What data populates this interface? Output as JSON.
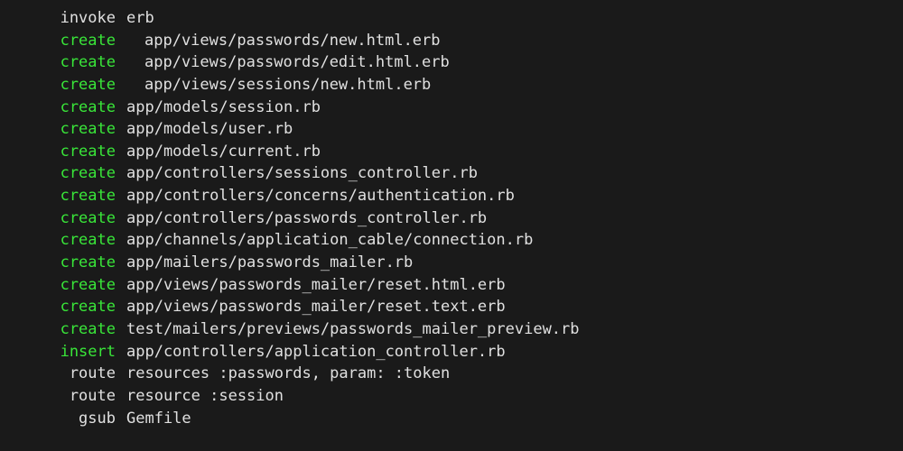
{
  "lines": [
    {
      "action": "invoke",
      "color": "white",
      "indent": false,
      "path": "erb"
    },
    {
      "action": "create",
      "color": "green",
      "indent": true,
      "path": "app/views/passwords/new.html.erb"
    },
    {
      "action": "create",
      "color": "green",
      "indent": true,
      "path": "app/views/passwords/edit.html.erb"
    },
    {
      "action": "create",
      "color": "green",
      "indent": true,
      "path": "app/views/sessions/new.html.erb"
    },
    {
      "action": "create",
      "color": "green",
      "indent": false,
      "path": "app/models/session.rb"
    },
    {
      "action": "create",
      "color": "green",
      "indent": false,
      "path": "app/models/user.rb"
    },
    {
      "action": "create",
      "color": "green",
      "indent": false,
      "path": "app/models/current.rb"
    },
    {
      "action": "create",
      "color": "green",
      "indent": false,
      "path": "app/controllers/sessions_controller.rb"
    },
    {
      "action": "create",
      "color": "green",
      "indent": false,
      "path": "app/controllers/concerns/authentication.rb"
    },
    {
      "action": "create",
      "color": "green",
      "indent": false,
      "path": "app/controllers/passwords_controller.rb"
    },
    {
      "action": "create",
      "color": "green",
      "indent": false,
      "path": "app/channels/application_cable/connection.rb"
    },
    {
      "action": "create",
      "color": "green",
      "indent": false,
      "path": "app/mailers/passwords_mailer.rb"
    },
    {
      "action": "create",
      "color": "green",
      "indent": false,
      "path": "app/views/passwords_mailer/reset.html.erb"
    },
    {
      "action": "create",
      "color": "green",
      "indent": false,
      "path": "app/views/passwords_mailer/reset.text.erb"
    },
    {
      "action": "create",
      "color": "green",
      "indent": false,
      "path": "test/mailers/previews/passwords_mailer_preview.rb"
    },
    {
      "action": "insert",
      "color": "green",
      "indent": false,
      "path": "app/controllers/application_controller.rb"
    },
    {
      "action": "route",
      "color": "white",
      "indent": false,
      "path": "resources :passwords, param: :token"
    },
    {
      "action": "route",
      "color": "white",
      "indent": false,
      "path": "resource :session"
    },
    {
      "action": "gsub",
      "color": "white",
      "indent": false,
      "path": "Gemfile"
    }
  ]
}
